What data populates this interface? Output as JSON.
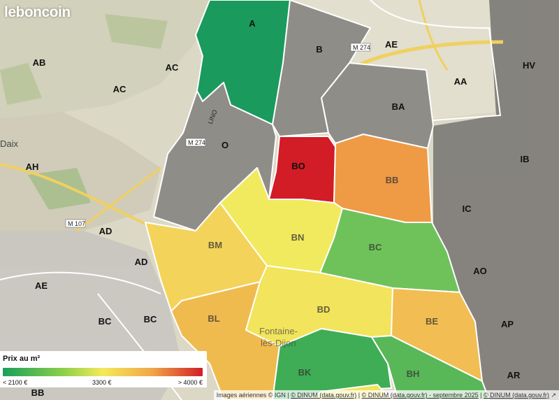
{
  "brand": {
    "logo_text": "leboncoin"
  },
  "map": {
    "districts": [
      {
        "id": "A",
        "fill": "#1a9a5c"
      },
      {
        "id": "B",
        "fill": "#8f8d88"
      },
      {
        "id": "O",
        "fill": "#8f8d88"
      },
      {
        "id": "BA",
        "fill": "#8f8d88"
      },
      {
        "id": "BO",
        "fill": "#d21c26"
      },
      {
        "id": "BB",
        "fill": "#ef9a45"
      },
      {
        "id": "BN",
        "fill": "#f1ea5e"
      },
      {
        "id": "BM",
        "fill": "#f3d35a"
      },
      {
        "id": "BC",
        "fill": "#6fc25a"
      },
      {
        "id": "BL",
        "fill": "#f0bb4e"
      },
      {
        "id": "BD",
        "fill": "#f2e45c"
      },
      {
        "id": "BE",
        "fill": "#f2bd52"
      },
      {
        "id": "BK",
        "fill": "#3fad55"
      },
      {
        "id": "BH",
        "fill": "#58b858"
      }
    ],
    "outer_labels": [
      "AB",
      "AC",
      "AC",
      "AH",
      "AD",
      "AD",
      "AE",
      "BC",
      "BC",
      "BB",
      "AE",
      "AA",
      "HV",
      "IB",
      "IC",
      "AO",
      "AP",
      "AR"
    ],
    "place_names": {
      "daix": "Daix",
      "fontaine_1": "Fontaine-",
      "fontaine_2": "lès-Dijon"
    },
    "roads": {
      "m274_a": "M 274",
      "m274_b": "M 274",
      "m107": "M 107",
      "lino": "LINO"
    }
  },
  "legend": {
    "title": "Prix au m²",
    "min_label": "< 2100 €",
    "mid_label": "3300 €",
    "max_label": "> 4000 €",
    "gradient_colors": [
      "#19a05a",
      "#8ccf4a",
      "#f4ea5a",
      "#f0a548",
      "#d21c26"
    ]
  },
  "attribution": {
    "part1": "Images aériennes © IGN",
    "part2": "© DINUM (data.gouv.fr)",
    "part3": "© DINUM (data.gouv.fr) - septembre 2025",
    "part4": "© DINUM (data.gouv.fr)"
  }
}
